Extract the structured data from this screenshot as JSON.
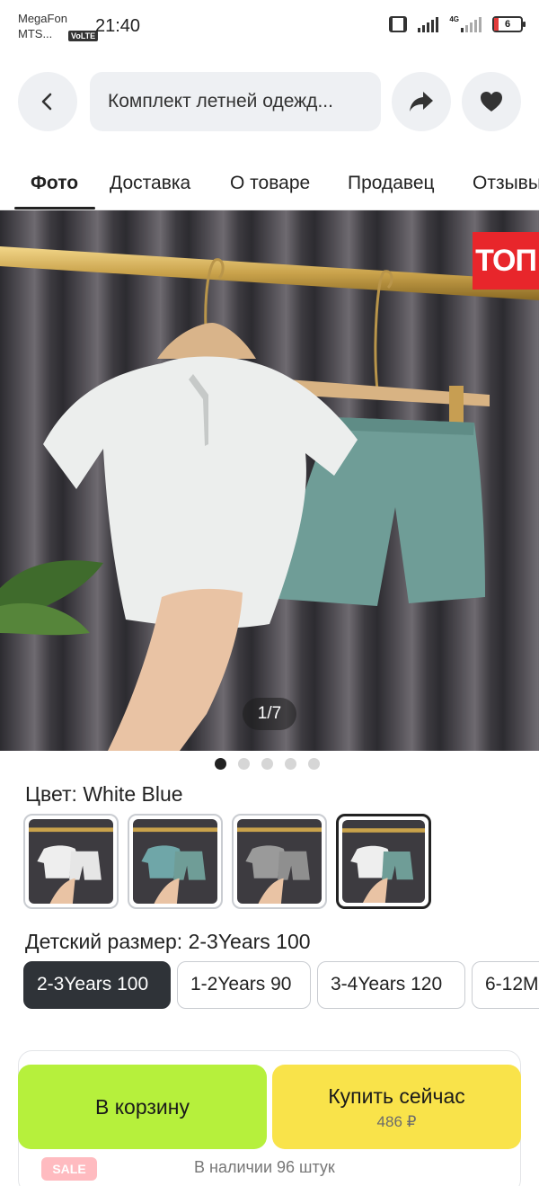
{
  "status_bar": {
    "carrier_1": "MegaFon",
    "carrier_2": "MTS...",
    "volte": "VoLTE",
    "time": "21:40",
    "network": "4G",
    "battery": "6"
  },
  "header": {
    "search_text": "Комплект летней одежд..."
  },
  "tabs": [
    {
      "label": "Фото",
      "active": true
    },
    {
      "label": "Доставка"
    },
    {
      "label": "О товаре"
    },
    {
      "label": "Продавец"
    },
    {
      "label": "Отзывы"
    }
  ],
  "gallery": {
    "badge": "ТОП",
    "counter": "1/7",
    "current_index": 1,
    "total_dots": 5
  },
  "color": {
    "label": "Цвет: White Blue",
    "options": [
      "white",
      "blue",
      "grey",
      "white-blue"
    ],
    "selected_index": 3
  },
  "size": {
    "label": "Детский размер: 2-3Years 100",
    "options": [
      "2-3Years 100",
      "1-2Years 90",
      "3-4Years 120",
      "6-12M"
    ],
    "selected_index": 0
  },
  "bottom": {
    "sale": "SALE",
    "stock": "В наличии 96 штук",
    "cart_label": "В корзину",
    "buy_label": "Купить сейчас",
    "price": "486 ₽"
  },
  "colors": {
    "cart": "#b6f03c",
    "buy": "#f9e34a",
    "badge": "#e8262b"
  }
}
